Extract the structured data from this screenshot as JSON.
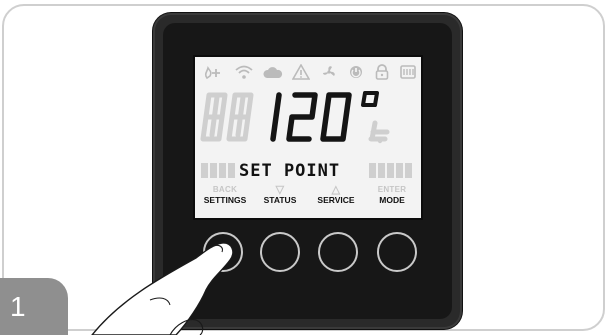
{
  "step": {
    "number": "1"
  },
  "display": {
    "reading_digits": "120",
    "reading_unit": "F",
    "label": "SET POINT",
    "status_icons": [
      "heat-boost-icon",
      "wifi-icon",
      "cloud-icon",
      "warning-icon",
      "fan-icon",
      "power-circle-icon",
      "lock-icon",
      "heater-icon"
    ]
  },
  "buttons": [
    {
      "top": "BACK",
      "main": "SETTINGS"
    },
    {
      "top": "▽",
      "main": "STATUS"
    },
    {
      "top": "△",
      "main": "SERVICE"
    },
    {
      "top": "ENTER",
      "main": "MODE"
    }
  ],
  "colors": {
    "bezel": "#2a2a2a",
    "lcd_background": "#f3f3f3",
    "badge": "#8f8f8f"
  }
}
